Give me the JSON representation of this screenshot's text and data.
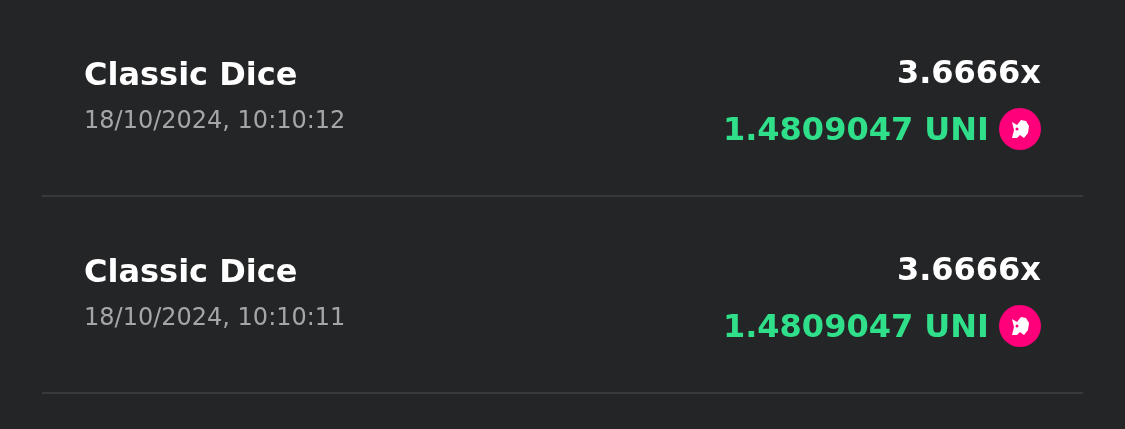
{
  "bets": [
    {
      "game": "Classic Dice",
      "time": "18/10/2024, 10:10:12",
      "multiplier": "3.6666x",
      "payout": "1.4809047 UNI",
      "won": true
    },
    {
      "game": "Classic Dice",
      "time": "18/10/2024, 10:10:11",
      "multiplier": "3.6666x",
      "payout": "1.4809047 UNI",
      "won": true
    }
  ]
}
